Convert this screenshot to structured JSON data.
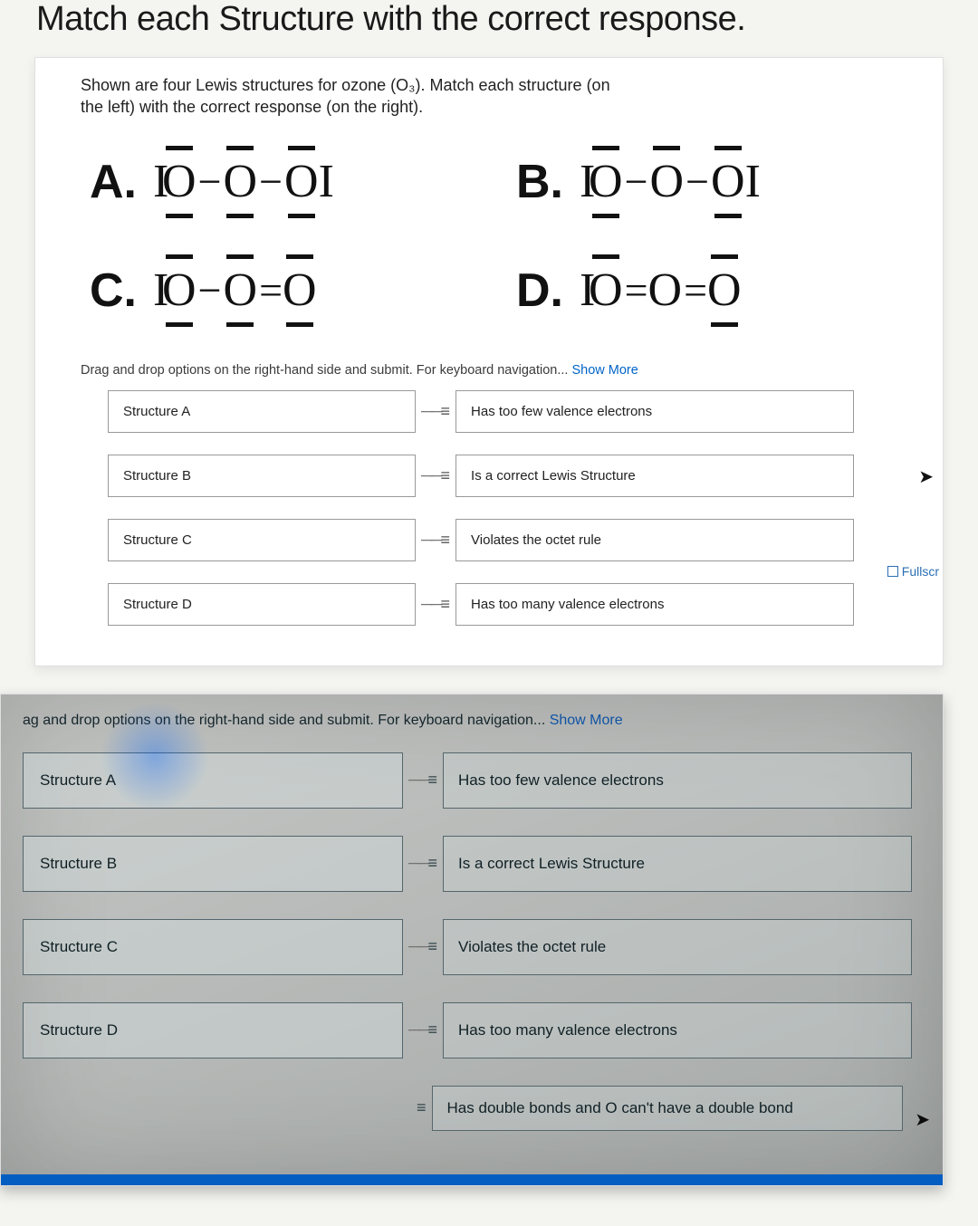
{
  "page_title": "Match each Structure with the correct response.",
  "prompt": "Shown are four Lewis structures for ozone (O₃). Match each structure (on the left) with the correct response (on the right).",
  "structures": {
    "A": {
      "label": "A.",
      "formula_desc": "|O−O−O| all three O with lone pairs top and bottom"
    },
    "B": {
      "label": "B.",
      "formula_desc": "|O−O−O| outer O lone pairs top+bottom, center O lone pair top only"
    },
    "C": {
      "label": "C.",
      "formula_desc": "|O−O=O left O lone pairs top+bottom, center top+bottom, right top+bottom"
    },
    "D": {
      "label": "D.",
      "formula_desc": "|O=O=O left top, right top+bottom"
    }
  },
  "instructions_prefix": "Drag and drop options on the right-hand side and submit. For keyboard navigation... ",
  "instructions_link": "Show More",
  "matches_card1": [
    {
      "left": "Structure A",
      "right": "Has too few valence electrons"
    },
    {
      "left": "Structure B",
      "right": "Is a correct Lewis Structure"
    },
    {
      "left": "Structure C",
      "right": "Violates the octet rule"
    },
    {
      "left": "Structure D",
      "right": "Has too many valence electrons"
    }
  ],
  "fullscreen_label": "Fullscr",
  "instructions2_prefix": "ag and drop options on the right-hand side and submit. For keyboard navigation... ",
  "matches_card2": [
    {
      "left": "Structure A",
      "right": "Has too few valence electrons"
    },
    {
      "left": "Structure B",
      "right": "Is a correct Lewis Structure"
    },
    {
      "left": "Structure C",
      "right": "Violates the octet rule"
    },
    {
      "left": "Structure D",
      "right": "Has too many valence electrons"
    }
  ],
  "extra_option": "Has double bonds and O can't have a double bond",
  "glyphs": {
    "O": "O",
    "pipe": "I",
    "single": "−",
    "double": "="
  }
}
